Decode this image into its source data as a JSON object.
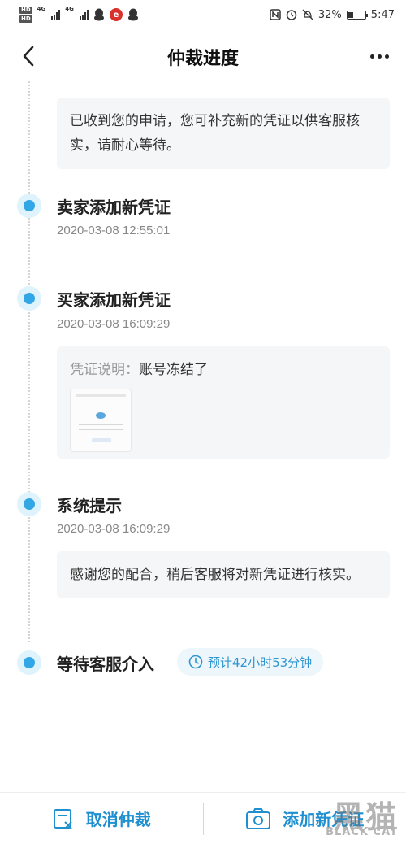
{
  "status_bar": {
    "hd_top": "HD",
    "hd_bottom": "HD",
    "net1": "4G",
    "net2": "4G",
    "battery_percent": "32%",
    "battery_level": 0.32,
    "time": "5:47",
    "icons": [
      "qq-icon",
      "notification-app-icon",
      "qq-icon",
      "nfc-icon",
      "alarm-icon",
      "mute-icon",
      "battery-icon"
    ]
  },
  "header": {
    "title": "仲裁进度"
  },
  "timeline": {
    "first_note": "已收到您的申请，您可补充新的凭证以供客服核实，请耐心等待。",
    "events": [
      {
        "title": "卖家添加新凭证",
        "time": "2020-03-08 12:55:01"
      },
      {
        "title": "买家添加新凭证",
        "time": "2020-03-08 16:09:29",
        "evidence_label": "凭证说明：",
        "evidence_text": "账号冻结了"
      },
      {
        "title": "系统提示",
        "time": "2020-03-08 16:09:29",
        "note": "感谢您的配合，稍后客服将对新凭证进行核实。"
      },
      {
        "title": "等待客服介入",
        "eta": "预计42小时53分钟"
      }
    ]
  },
  "bottom_bar": {
    "cancel_label": "取消仲裁",
    "add_label": "添加新凭证"
  },
  "watermark": {
    "cn": "黑猫",
    "en": "BLACK CAT"
  },
  "colors": {
    "accent": "#1f8fd0",
    "node": "#33a6e6",
    "card_bg": "#f5f6f7"
  }
}
